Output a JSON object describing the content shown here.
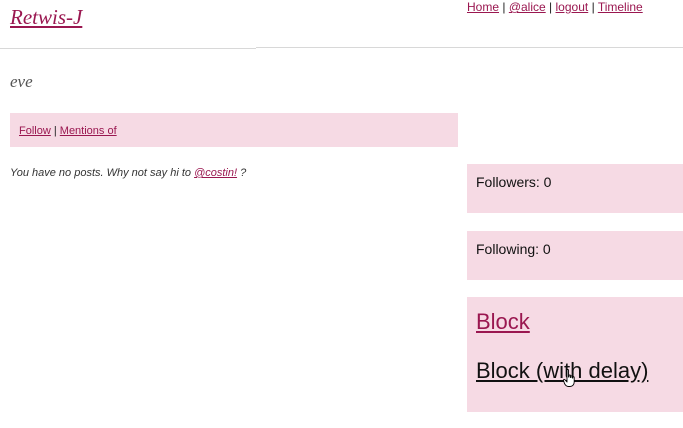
{
  "app": {
    "logo": "Retwis-J"
  },
  "topnav": {
    "home": "Home",
    "user": "@alice",
    "logout": "logout",
    "timeline": "Timeline",
    "separator": "|"
  },
  "profile": {
    "username": "eve",
    "tabs": {
      "follow": "Follow",
      "mentions": "Mentions of",
      "separator": "|"
    },
    "empty_message_prefix": "You have no posts. Why not say hi to",
    "empty_message_link": "@costin!",
    "empty_message_suffix": "?"
  },
  "sidebar": {
    "followers_label": "Followers: 0",
    "following_label": "Following: 0",
    "block_label": "Block",
    "block_delay_label": "Block (with delay)"
  },
  "colors": {
    "accent": "#9a1750",
    "panel_bg": "#f6dae4"
  },
  "icons": {
    "cursor": "hand-pointer-icon"
  }
}
